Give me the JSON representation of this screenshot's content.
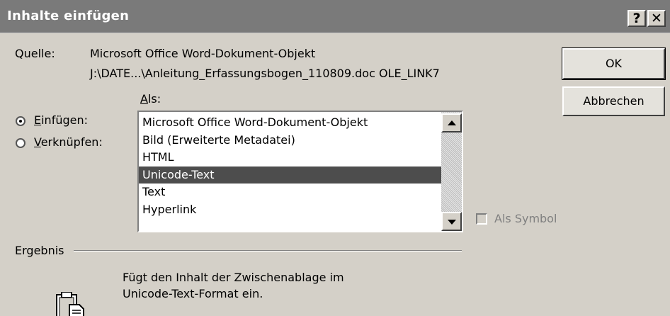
{
  "window": {
    "title": "Inhalte einfügen",
    "help_glyph": "?",
    "close_glyph": "✕"
  },
  "source": {
    "label": "Quelle:",
    "line1": "Microsoft Office Word-Dokument-Objekt",
    "line2": "J:\\DATE...\\Anleitung_Erfassungsbogen_110809.doc OLE_LINK7"
  },
  "buttons": {
    "ok": "OK",
    "cancel": "Abbrechen"
  },
  "as_label": {
    "mnemonic": "A",
    "rest": "ls:"
  },
  "options": {
    "paste": {
      "mnemonic": "E",
      "rest": "infügen:",
      "checked": true
    },
    "link": {
      "mnemonic": "V",
      "rest": "erknüpfen:",
      "checked": false
    }
  },
  "list": {
    "items": [
      "Microsoft Office Word-Dokument-Objekt",
      "Bild (Erweiterte Metadatei)",
      "HTML",
      "Unicode-Text",
      "Text",
      "Hyperlink"
    ],
    "selected": "Unicode-Text"
  },
  "symbol_checkbox": {
    "label": "Als Symbol",
    "checked": false,
    "enabled": false
  },
  "result": {
    "label": "Ergebnis",
    "line1": "Fügt den Inhalt der Zwischenablage im",
    "line2": "Unicode-Text-Format ein."
  }
}
